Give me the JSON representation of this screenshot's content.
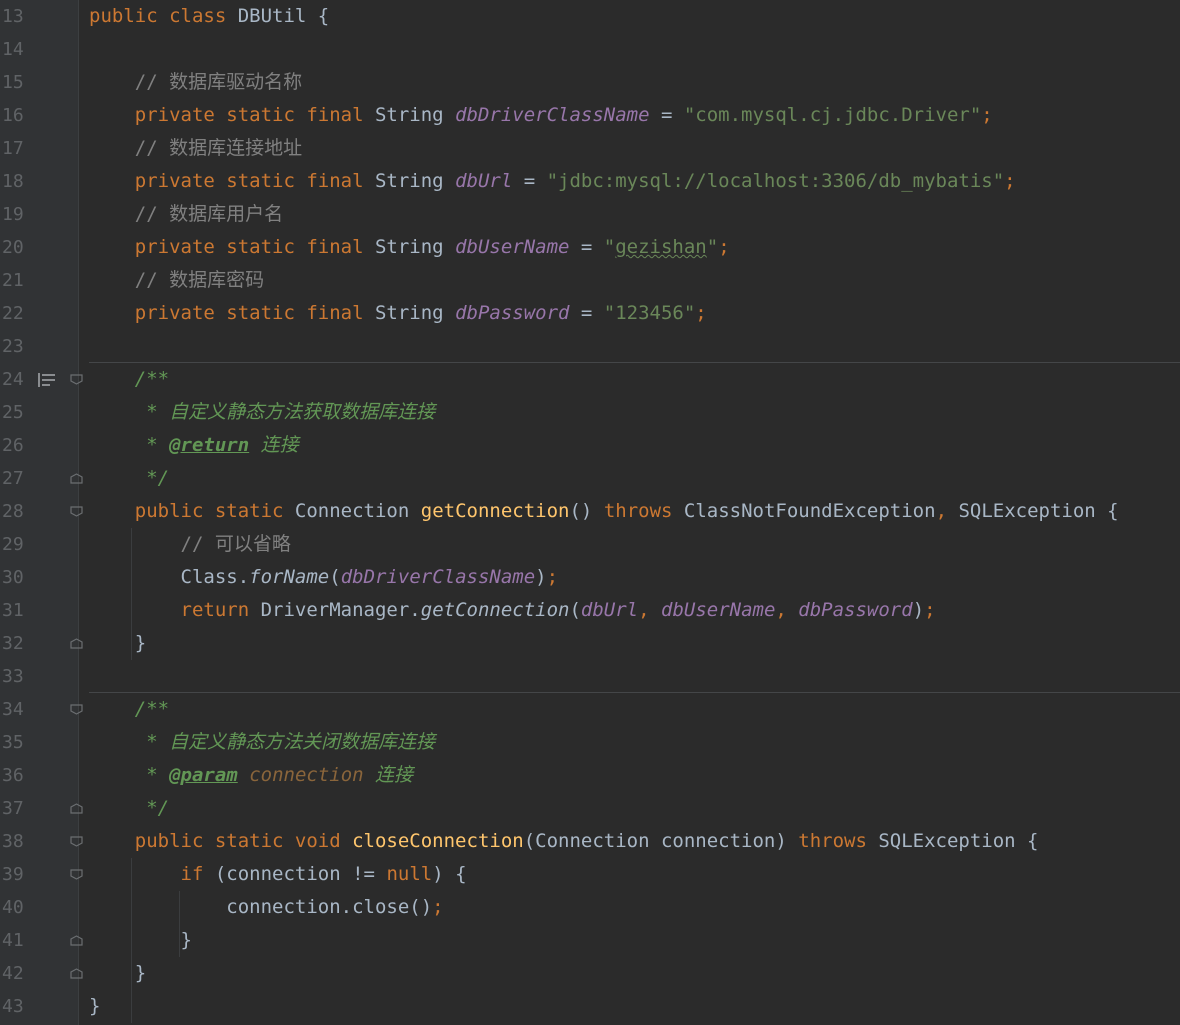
{
  "editor": {
    "lines": [
      {
        "n": "13",
        "tokens": [
          [
            "kw",
            "public "
          ],
          [
            "kw",
            "class "
          ],
          [
            "p",
            "DBUtil {"
          ]
        ]
      },
      {
        "n": "14",
        "tokens": []
      },
      {
        "n": "15",
        "tokens": [
          [
            "p",
            "    "
          ],
          [
            "cm",
            "// 数据库驱动名称"
          ]
        ]
      },
      {
        "n": "16",
        "tokens": [
          [
            "p",
            "    "
          ],
          [
            "kw",
            "private static final "
          ],
          [
            "p",
            "String "
          ],
          [
            "fld",
            "dbDriverClassName"
          ],
          [
            "p",
            " = "
          ],
          [
            "str",
            "\"com.mysql.cj.jdbc.Driver\""
          ],
          [
            "kw",
            ";"
          ]
        ]
      },
      {
        "n": "17",
        "tokens": [
          [
            "p",
            "    "
          ],
          [
            "cm",
            "// 数据库连接地址"
          ]
        ]
      },
      {
        "n": "18",
        "tokens": [
          [
            "p",
            "    "
          ],
          [
            "kw",
            "private static final "
          ],
          [
            "p",
            "String "
          ],
          [
            "fld",
            "dbUrl"
          ],
          [
            "p",
            " = "
          ],
          [
            "str",
            "\"jdbc:mysql://localhost:3306/db_mybatis\""
          ],
          [
            "kw",
            ";"
          ]
        ]
      },
      {
        "n": "19",
        "tokens": [
          [
            "p",
            "    "
          ],
          [
            "cm",
            "// 数据库用户名"
          ]
        ]
      },
      {
        "n": "20",
        "tokens": [
          [
            "p",
            "    "
          ],
          [
            "kw",
            "private static final "
          ],
          [
            "p",
            "String "
          ],
          [
            "fld",
            "dbUserName"
          ],
          [
            "p",
            " = "
          ],
          [
            "str",
            "\""
          ],
          [
            "strsq",
            "gezishan"
          ],
          [
            "str",
            "\""
          ],
          [
            "kw",
            ";"
          ]
        ]
      },
      {
        "n": "21",
        "tokens": [
          [
            "p",
            "    "
          ],
          [
            "cm",
            "// 数据库密码"
          ]
        ]
      },
      {
        "n": "22",
        "tokens": [
          [
            "p",
            "    "
          ],
          [
            "kw",
            "private static final "
          ],
          [
            "p",
            "String "
          ],
          [
            "fld",
            "dbPassword"
          ],
          [
            "p",
            " = "
          ],
          [
            "str",
            "\"123456\""
          ],
          [
            "kw",
            ";"
          ]
        ]
      },
      {
        "n": "23",
        "tokens": []
      },
      {
        "n": "24",
        "tokens": [
          [
            "p",
            "    "
          ],
          [
            "doc",
            "/**"
          ]
        ]
      },
      {
        "n": "25",
        "tokens": [
          [
            "p",
            "     "
          ],
          [
            "doc",
            "* 自定义静态方法获取数据库连接"
          ]
        ]
      },
      {
        "n": "26",
        "tokens": [
          [
            "p",
            "     "
          ],
          [
            "doc",
            "* "
          ],
          [
            "doctag",
            "@return"
          ],
          [
            "doc",
            " 连接"
          ]
        ]
      },
      {
        "n": "27",
        "tokens": [
          [
            "p",
            "     "
          ],
          [
            "doc",
            "*/"
          ]
        ]
      },
      {
        "n": "28",
        "tokens": [
          [
            "p",
            "    "
          ],
          [
            "kw",
            "public static "
          ],
          [
            "p",
            "Connection "
          ],
          [
            "fn",
            "getConnection"
          ],
          [
            "p",
            "() "
          ],
          [
            "kw",
            "throws "
          ],
          [
            "p",
            "ClassNotFoundException"
          ],
          [
            "kw",
            ", "
          ],
          [
            "p",
            "SQLException {"
          ]
        ]
      },
      {
        "n": "29",
        "tokens": [
          [
            "p",
            "        "
          ],
          [
            "cm",
            "// 可以省略"
          ]
        ]
      },
      {
        "n": "30",
        "tokens": [
          [
            "p",
            "        Class."
          ],
          [
            "smeth",
            "forName"
          ],
          [
            "p",
            "("
          ],
          [
            "fld",
            "dbDriverClassName"
          ],
          [
            "p",
            ")"
          ],
          [
            "kw",
            ";"
          ]
        ]
      },
      {
        "n": "31",
        "tokens": [
          [
            "p",
            "        "
          ],
          [
            "kw",
            "return "
          ],
          [
            "p",
            "DriverManager."
          ],
          [
            "smeth",
            "getConnection"
          ],
          [
            "p",
            "("
          ],
          [
            "fld",
            "dbUrl"
          ],
          [
            "kw",
            ", "
          ],
          [
            "fld",
            "dbUserName"
          ],
          [
            "kw",
            ", "
          ],
          [
            "fld",
            "dbPassword"
          ],
          [
            "p",
            ")"
          ],
          [
            "kw",
            ";"
          ]
        ]
      },
      {
        "n": "32",
        "tokens": [
          [
            "p",
            "    }"
          ]
        ]
      },
      {
        "n": "33",
        "tokens": []
      },
      {
        "n": "34",
        "tokens": [
          [
            "p",
            "    "
          ],
          [
            "doc",
            "/**"
          ]
        ]
      },
      {
        "n": "35",
        "tokens": [
          [
            "p",
            "     "
          ],
          [
            "doc",
            "* 自定义静态方法关闭数据库连接"
          ]
        ]
      },
      {
        "n": "36",
        "tokens": [
          [
            "p",
            "     "
          ],
          [
            "doc",
            "* "
          ],
          [
            "doctag",
            "@param"
          ],
          [
            "doc",
            " "
          ],
          [
            "docparam",
            "connection"
          ],
          [
            "doc",
            " 连接"
          ]
        ]
      },
      {
        "n": "37",
        "tokens": [
          [
            "p",
            "     "
          ],
          [
            "doc",
            "*/"
          ]
        ]
      },
      {
        "n": "38",
        "tokens": [
          [
            "p",
            "    "
          ],
          [
            "kw",
            "public static void "
          ],
          [
            "fn",
            "closeConnection"
          ],
          [
            "p",
            "(Connection connection) "
          ],
          [
            "kw",
            "throws "
          ],
          [
            "p",
            "SQLException {"
          ]
        ]
      },
      {
        "n": "39",
        "tokens": [
          [
            "p",
            "        "
          ],
          [
            "kw",
            "if "
          ],
          [
            "p",
            "(connection != "
          ],
          [
            "kw",
            "null"
          ],
          [
            "p",
            ") {"
          ]
        ]
      },
      {
        "n": "40",
        "tokens": [
          [
            "p",
            "            connection.close()"
          ],
          [
            "kw",
            ";"
          ]
        ]
      },
      {
        "n": "41",
        "tokens": [
          [
            "p",
            "        }"
          ]
        ]
      },
      {
        "n": "42",
        "tokens": [
          [
            "p",
            "    }"
          ]
        ]
      },
      {
        "n": "43",
        "tokens": [
          [
            "p",
            "}"
          ]
        ]
      }
    ],
    "fold_lines": [
      "24",
      "27",
      "28",
      "32",
      "34",
      "37",
      "38",
      "39",
      "41",
      "42"
    ],
    "doc_render_icon_line": "24",
    "icons": {
      "fold": "fold-marker-icon",
      "doc_render": "render-doc-icon"
    },
    "colors": {
      "background": "#2b2b2b",
      "keyword": "#cc7832",
      "string": "#6a8759",
      "field": "#9876aa",
      "method": "#ffc66d",
      "comment": "#808080",
      "doc": "#629755"
    }
  }
}
